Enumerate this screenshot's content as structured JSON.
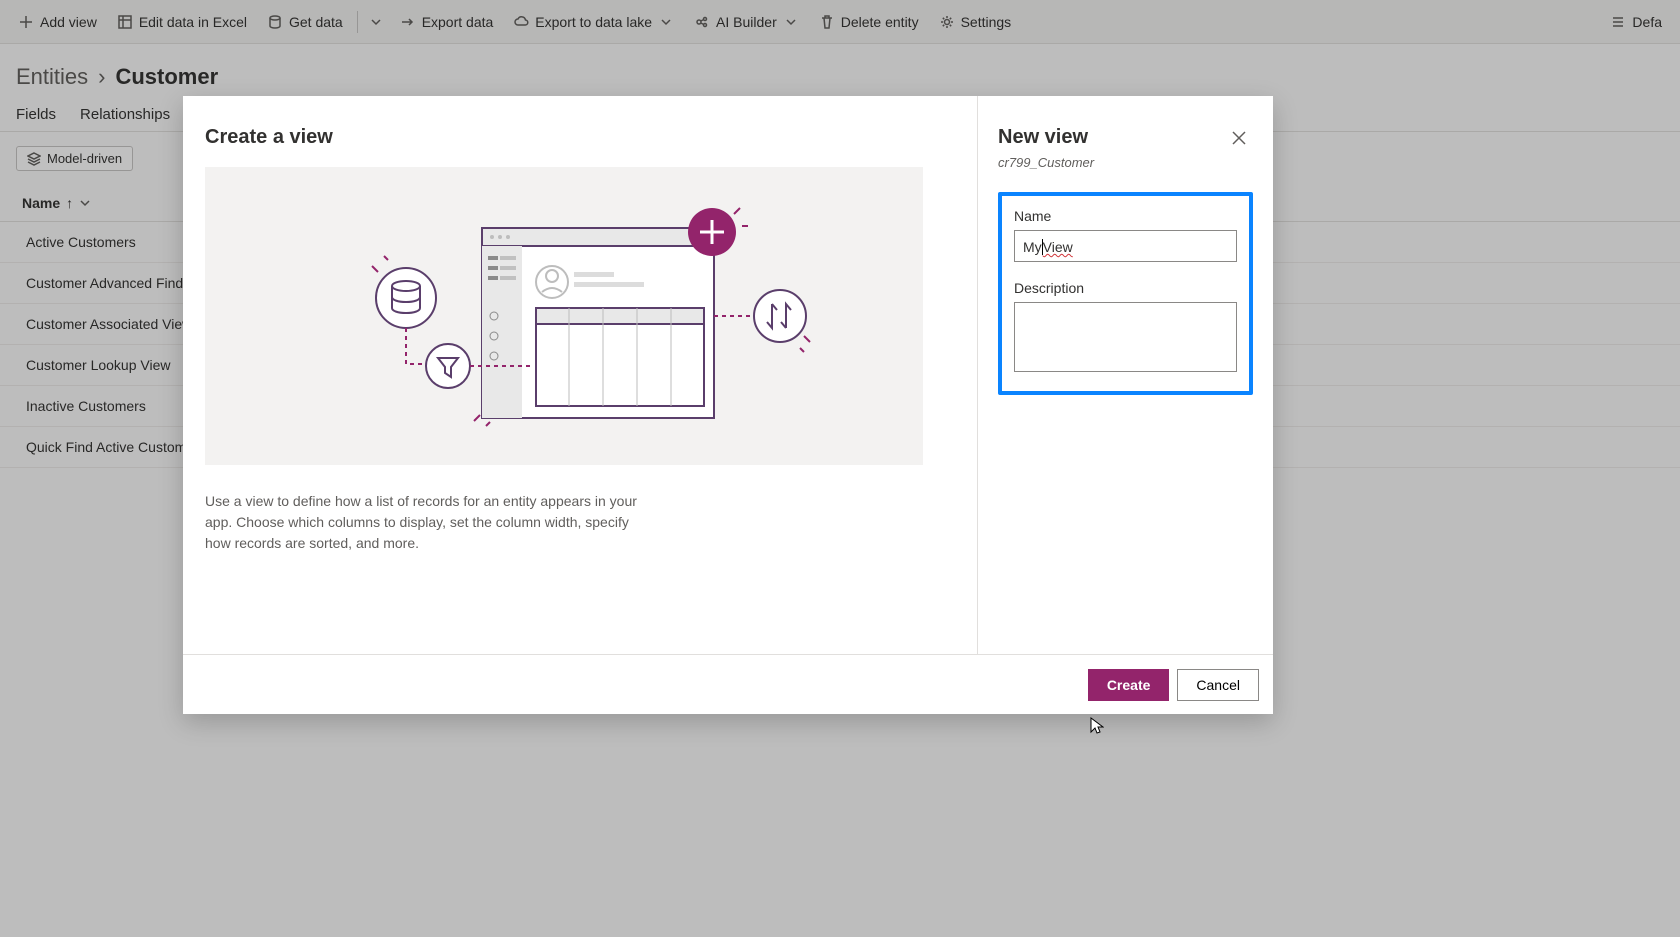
{
  "commandBar": {
    "addView": "Add view",
    "editExcel": "Edit data in Excel",
    "getData": "Get data",
    "exportData": "Export data",
    "exportLake": "Export to data lake",
    "aiBuilder": "AI Builder",
    "deleteEntity": "Delete entity",
    "settings": "Settings",
    "defaultLabel": "Defa"
  },
  "breadcrumb": {
    "parent": "Entities",
    "current": "Customer"
  },
  "tabs": {
    "fields": "Fields",
    "relationships": "Relationships"
  },
  "chip": "Model-driven",
  "listHeader": "Name",
  "listItems": [
    "Active Customers",
    "Customer Advanced Find",
    "Customer Associated View",
    "Customer Lookup View",
    "Inactive Customers",
    "Quick Find Active Custom"
  ],
  "modal": {
    "title": "Create a view",
    "description": "Use a view to define how a list of records for an entity appears in your app. Choose which columns to display, set the column width, specify how records are sorted, and more.",
    "sideTitle": "New view",
    "entityName": "cr799_Customer",
    "nameLabel": "Name",
    "nameValue": "MyView",
    "descLabel": "Description",
    "descValue": "",
    "createBtn": "Create",
    "cancelBtn": "Cancel"
  }
}
